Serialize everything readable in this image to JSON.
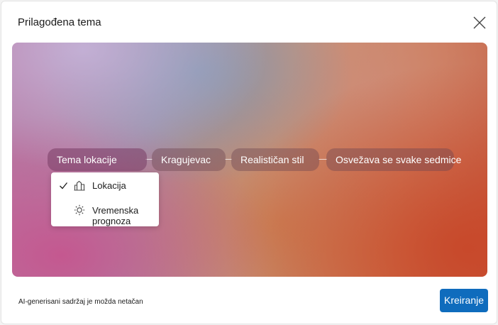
{
  "dialog": {
    "title": "Prilagođena tema",
    "close_icon": "close-icon"
  },
  "pills": [
    {
      "label": "Tema lokacije",
      "active": true
    },
    {
      "label": "Kragujevac",
      "active": false
    },
    {
      "label": "Realističan stil",
      "active": false
    },
    {
      "label": "Osvežava se svake sedmice",
      "active": false
    }
  ],
  "dropdown": {
    "items": [
      {
        "label": "Lokacija",
        "icon": "city-icon",
        "selected": true
      },
      {
        "label": "Vremenska prognoza",
        "icon": "sun-icon",
        "selected": false
      }
    ]
  },
  "footer": {
    "disclaimer": "AI-generisani sadržaj je možda netačan",
    "create_label": "Kreiranje"
  },
  "colors": {
    "accent": "#0f6cbd"
  }
}
